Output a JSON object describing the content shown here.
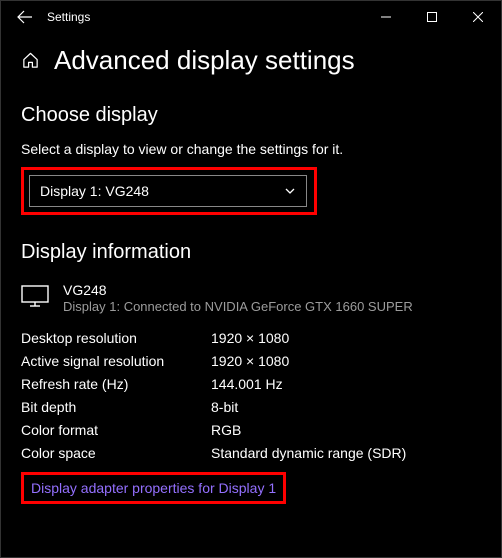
{
  "window": {
    "title": "Settings"
  },
  "page": {
    "heading": "Advanced display settings"
  },
  "choose": {
    "heading": "Choose display",
    "subtext": "Select a display to view or change the settings for it.",
    "selected": "Display 1: VG248"
  },
  "info": {
    "heading": "Display information",
    "monitor_name": "VG248",
    "monitor_sub": "Display 1: Connected to NVIDIA GeForce GTX 1660 SUPER",
    "specs": [
      {
        "label": "Desktop resolution",
        "value": "1920 × 1080"
      },
      {
        "label": "Active signal resolution",
        "value": "1920 × 1080"
      },
      {
        "label": "Refresh rate (Hz)",
        "value": "144.001 Hz"
      },
      {
        "label": "Bit depth",
        "value": "8-bit"
      },
      {
        "label": "Color format",
        "value": "RGB"
      },
      {
        "label": "Color space",
        "value": "Standard dynamic range (SDR)"
      }
    ],
    "adapter_link": "Display adapter properties for Display 1"
  }
}
